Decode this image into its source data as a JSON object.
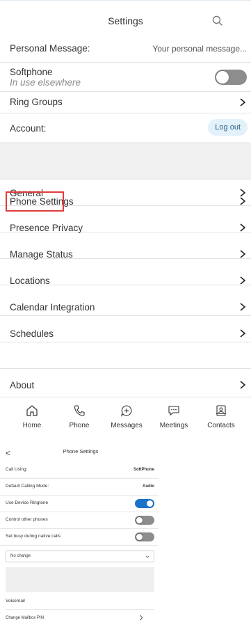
{
  "settings": {
    "title": "Settings",
    "rows": {
      "personal_message_label": "Personal Message:",
      "personal_message_value": "Your personal message...",
      "softphone_label": "Softphone",
      "softphone_sub": "In use elsewhere",
      "ring_groups": "Ring Groups",
      "account_label": "Account:",
      "logout": "Log out",
      "general": "General",
      "phone_settings": "Phone Settings",
      "presence_privacy": "Presence Privacy",
      "manage_status": "Manage Status",
      "locations": "Locations",
      "calendar_integration": "Calendar Integration",
      "schedules": "Schedules",
      "about": "About"
    },
    "softphone_toggle_on": false,
    "highlight_color": "#e23c3c"
  },
  "nav": {
    "items": [
      {
        "label": "Home",
        "icon": "home-icon"
      },
      {
        "label": "Phone",
        "icon": "phone-icon"
      },
      {
        "label": "Messages",
        "icon": "messages-icon"
      },
      {
        "label": "Meetings",
        "icon": "meetings-icon"
      },
      {
        "label": "Contacts",
        "icon": "contacts-icon"
      }
    ]
  },
  "phone_settings": {
    "back": "<",
    "title": "Phone Settings",
    "call_using_label": "Call Using:",
    "call_using_value": "SoftPhone",
    "default_mode_label": "Default Calling Mode:",
    "default_mode_value": "Audio",
    "use_device_ringtone": "Use Device Ringtone",
    "use_device_ringtone_on": true,
    "control_other_phones": "Control other phones",
    "control_other_phones_on": false,
    "set_busy": "Set busy during native calls",
    "set_busy_on": false,
    "dropdown_value": "No change",
    "voicemail_heading": "Voicemail",
    "change_pin": "Change Mailbox PIN",
    "accent_color": "#1a73c9"
  }
}
